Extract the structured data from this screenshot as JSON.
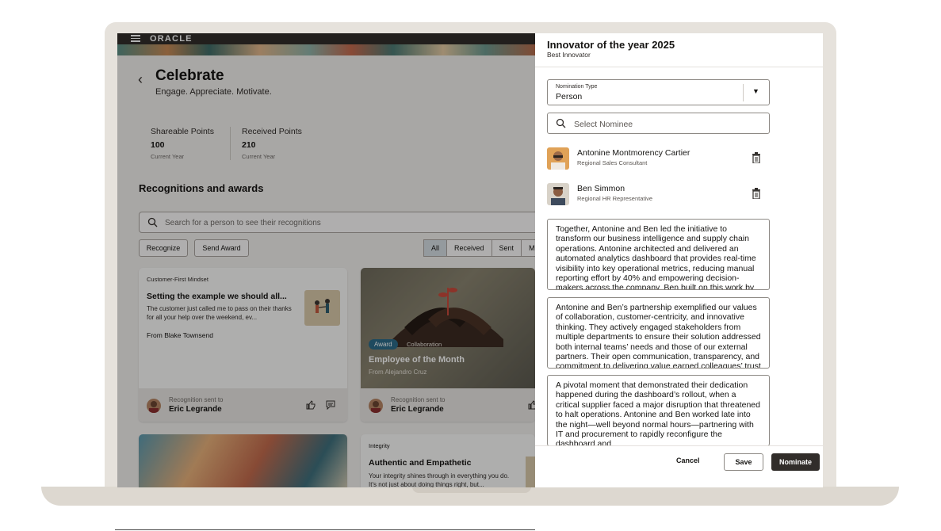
{
  "app": {
    "logo": "ORACLE"
  },
  "page": {
    "title": "Celebrate",
    "subtitle": "Engage. Appreciate. Motivate.",
    "points": [
      {
        "label": "Shareable Points",
        "value": "100",
        "caption": "Current Year"
      },
      {
        "label": "Received Points",
        "value": "210",
        "caption": "Current Year"
      }
    ],
    "section_title": "Recognitions and awards",
    "search_placeholder": "Search for a person to see their recognitions",
    "buttons": {
      "recognize": "Recognize",
      "send_award": "Send Award"
    },
    "filters": [
      "All",
      "Received",
      "Sent",
      "M"
    ],
    "cards": [
      {
        "tag": "Customer-First Mindset",
        "title": "Setting the example we should all...",
        "desc": "The customer just called me to pass on their thanks for all your help over the weekend, ev...",
        "from": "From Blake Townsend",
        "sent_label": "Recognition sent to",
        "sent_name": "Eric Legrande"
      },
      {
        "badge": "Award",
        "tag": "Collaboration",
        "title": "Employee of the Month",
        "from": "From Alejandro Cruz",
        "sent_label": "Recognition sent to",
        "sent_name": "Eric Legrande"
      },
      {
        "tag": "Integrity",
        "title": "Authentic and Empathetic",
        "desc": "Your integrity shines through in everything you do. It's not just about doing things right, but..."
      }
    ]
  },
  "drawer": {
    "title": "Innovator of the year 2025",
    "subtitle": "Best Innovator",
    "nomination_type": {
      "label": "Nomination Type",
      "value": "Person"
    },
    "nominee_placeholder": "Select Nominee",
    "nominees": [
      {
        "name": "Antonine Montmorency Cartier",
        "role": "Regional Sales Consultant"
      },
      {
        "name": "Ben Simmon",
        "role": "Regional HR Representative"
      }
    ],
    "texts": [
      "Together, Antonine and Ben led the initiative to transform our business intelligence and supply chain operations. Antonine architected and delivered an automated analytics dashboard that provides real-time visibility into key operational metrics, reducing manual reporting effort by 40% and empowering decision-makers across the company. Ben built on this work by",
      "Antonine and Ben’s partnership exemplified our values of collaboration, customer-centricity, and innovative thinking. They actively engaged stakeholders from multiple departments to ensure their solution addressed both internal teams’ needs and those of our external partners. Their open communication, transparency, and commitment to delivering value earned colleagues’ trust",
      "A pivotal moment that demonstrated their dedication happened during the dashboard’s rollout, when a critical supplier faced a major disruption that threatened to halt operations. Antonine and Ben worked late into the night—well beyond normal hours—partnering with IT and procurement to rapidly reconfigure the dashboard and"
    ],
    "actions": {
      "cancel": "Cancel",
      "save": "Save",
      "nominate": "Nominate"
    }
  }
}
